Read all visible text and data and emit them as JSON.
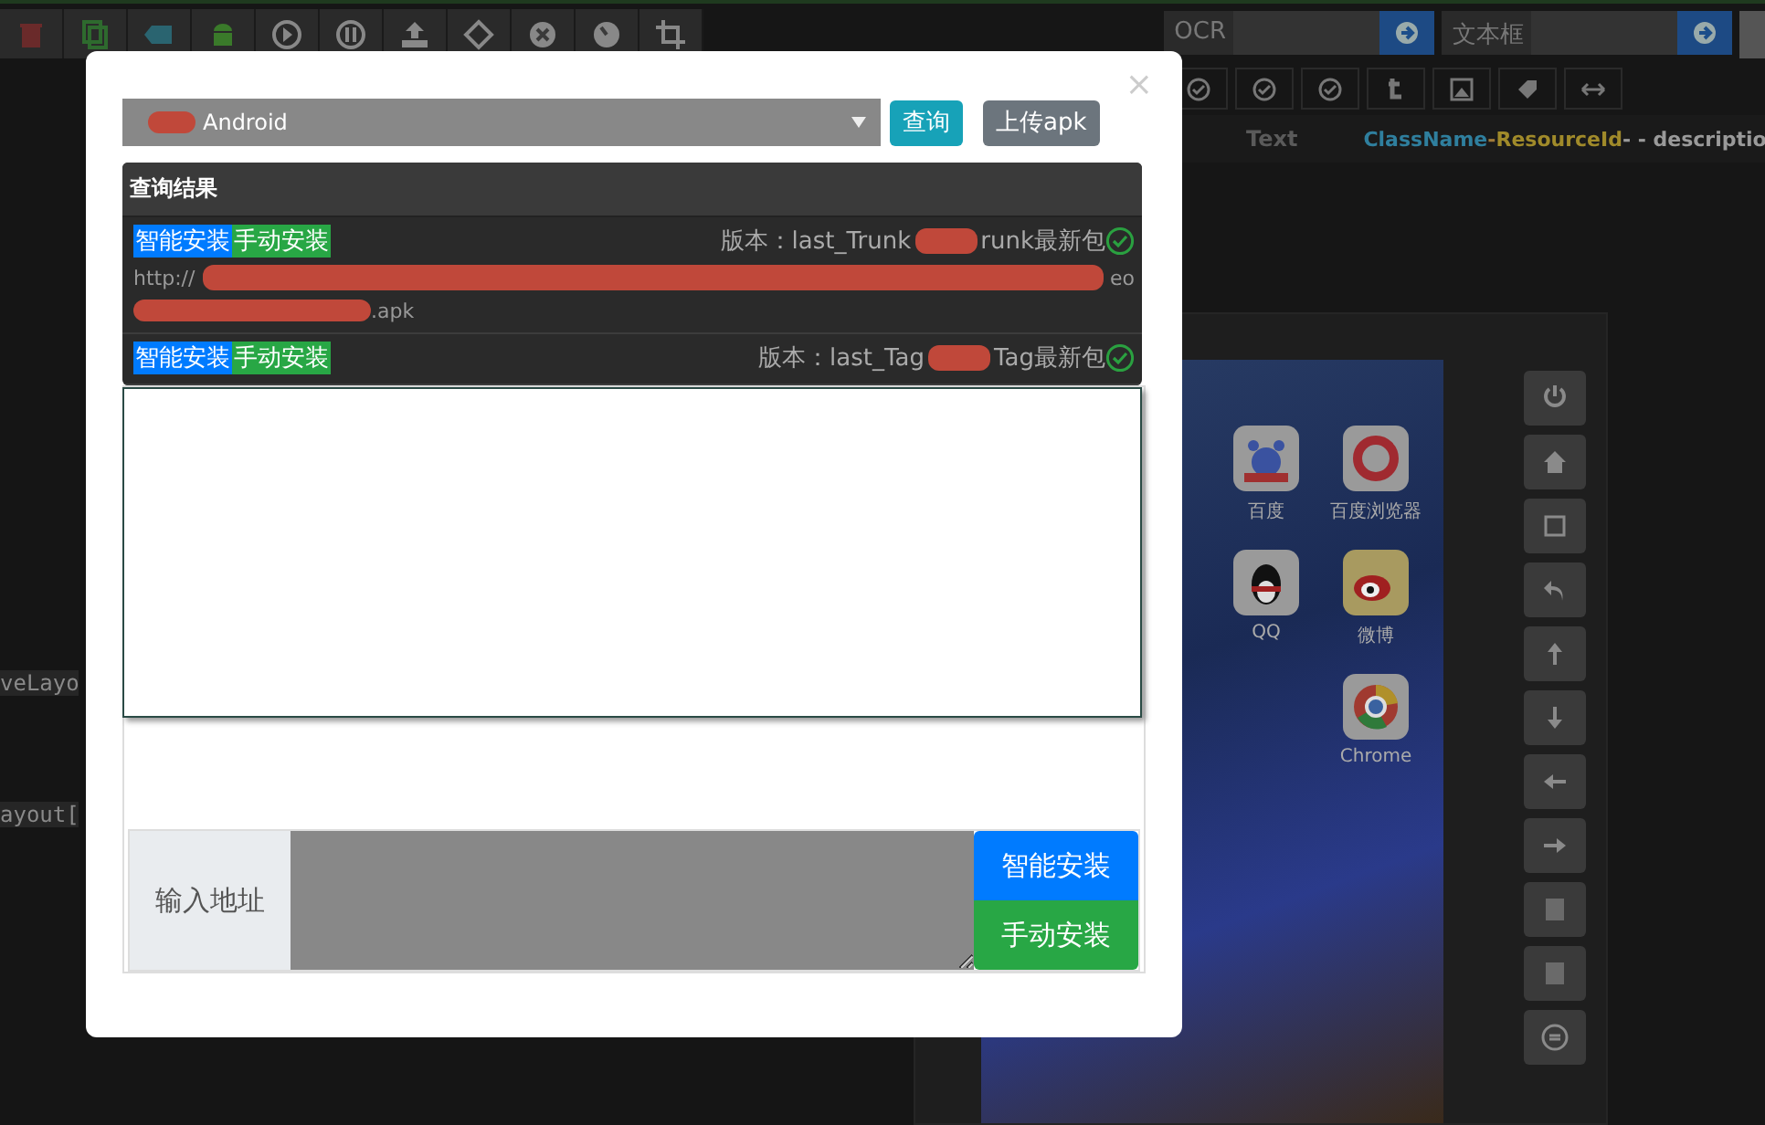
{
  "toolbar": {
    "fields": [
      {
        "label": "OCR"
      },
      {
        "label": "文本框"
      }
    ]
  },
  "inspector": {
    "text_column": "Text",
    "description_column": [
      {
        "text": "ClassName",
        "color": "#2f7f9e"
      },
      {
        "text": "-",
        "color": "#a07a3a"
      },
      {
        "text": "ResourceId",
        "color": "#a08a2a"
      },
      {
        "text": "- - descriptio",
        "color": "#9a9a9a"
      }
    ]
  },
  "code_lines": [
    "veLayo",
    "ayout["
  ],
  "device": {
    "apps": [
      {
        "label": "百度"
      },
      {
        "label": "百度浏览器"
      },
      {
        "label": "QQ"
      },
      {
        "label": "微博"
      },
      {
        "label": "Chrome"
      }
    ]
  },
  "modal": {
    "close": "×",
    "platform_select": {
      "value": "Android"
    },
    "buttons": [
      {
        "label": "查询",
        "kind": "query"
      },
      {
        "label": "上传apk",
        "kind": "upload"
      }
    ],
    "results": {
      "title": "查询结果",
      "rows": [
        {
          "actions": [
            "智能安装",
            "手动安装"
          ],
          "version_start": "版本：last_Trunk",
          "version_end": "runk最新包",
          "verified": true,
          "url": {
            "start": "http://",
            "end": "eo",
            "tail": ".apk"
          }
        },
        {
          "actions": [
            "智能安装",
            "手动安装"
          ],
          "version_start": "版本：last_Tag",
          "version_end": "Tag最新包",
          "verified": true
        }
      ]
    },
    "address": {
      "label": "输入地址",
      "buttons": [
        {
          "label": "智能安装",
          "kind": "smart"
        },
        {
          "label": "手动安装",
          "kind": "manual"
        }
      ]
    }
  }
}
